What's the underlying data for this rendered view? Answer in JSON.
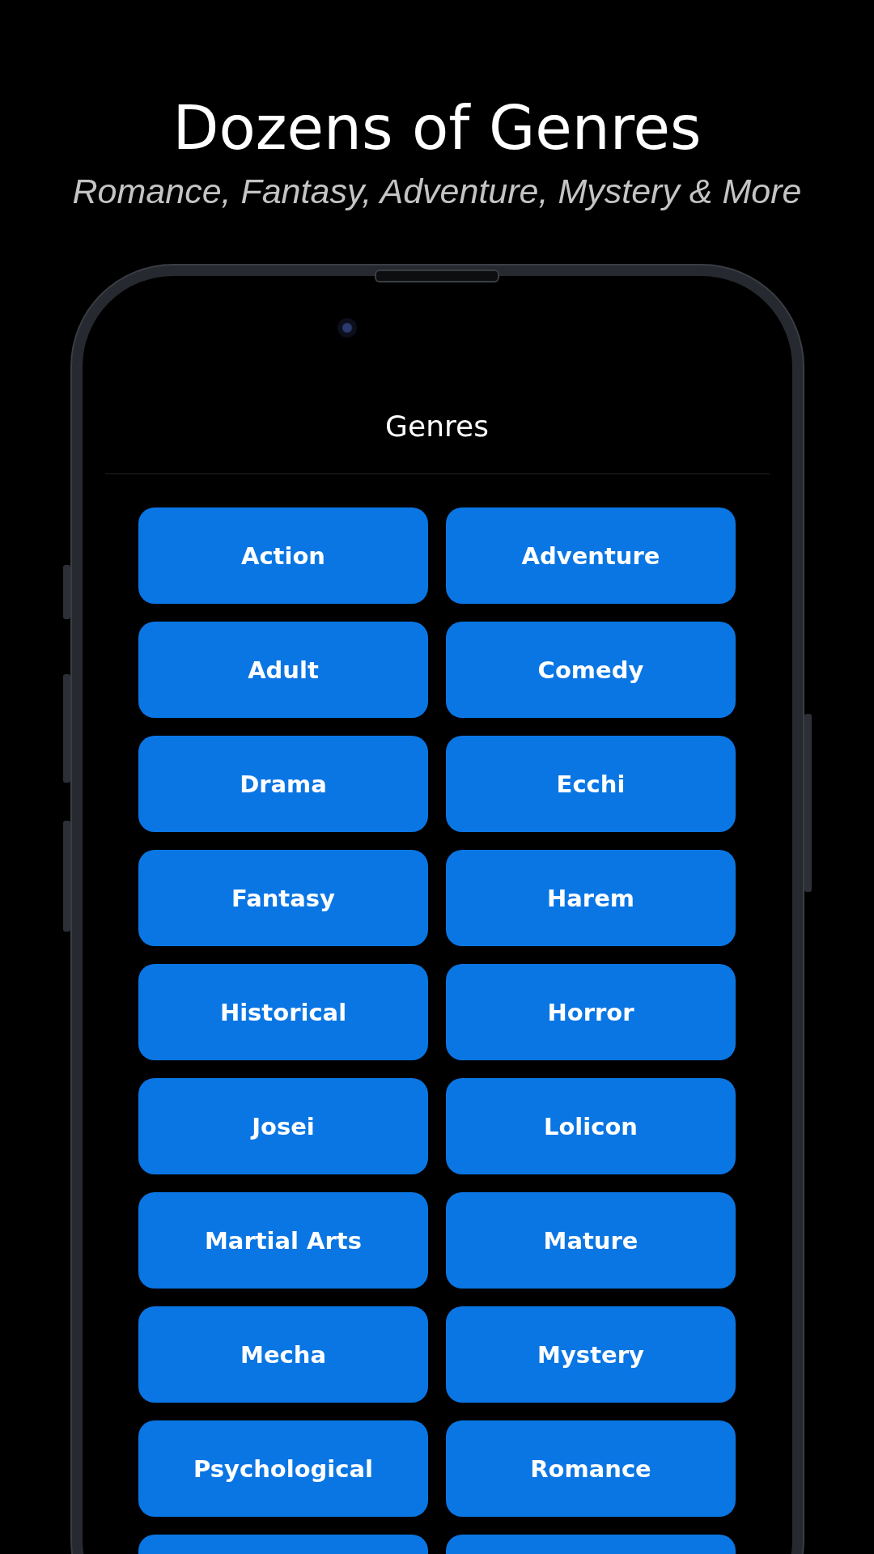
{
  "headline": {
    "title": "Dozens of Genres",
    "subtitle": "Romance, Fantasy, Adventure, Mystery & More"
  },
  "screen": {
    "title": "Genres",
    "genres": [
      {
        "kind": "full",
        "label": "Action"
      },
      {
        "kind": "full",
        "label": "Adventure"
      },
      {
        "kind": "full",
        "label": "Adult"
      },
      {
        "kind": "full",
        "label": "Comedy"
      },
      {
        "kind": "full",
        "label": "Drama"
      },
      {
        "kind": "full",
        "label": "Ecchi"
      },
      {
        "kind": "full",
        "label": "Fantasy"
      },
      {
        "kind": "full",
        "label": "Harem"
      },
      {
        "kind": "full",
        "label": "Historical"
      },
      {
        "kind": "full",
        "label": "Horror"
      },
      {
        "kind": "full",
        "label": "Josei"
      },
      {
        "kind": "full",
        "label": "Lolicon"
      },
      {
        "kind": "full",
        "label": "Martial Arts"
      },
      {
        "kind": "full",
        "label": "Mature"
      },
      {
        "kind": "full",
        "label": "Mecha"
      },
      {
        "kind": "full",
        "label": "Mystery"
      },
      {
        "kind": "full",
        "label": "Psychological"
      },
      {
        "kind": "full",
        "label": "Romance"
      },
      {
        "kind": "cut_off"
      },
      {
        "kind": "cut_off"
      }
    ]
  }
}
